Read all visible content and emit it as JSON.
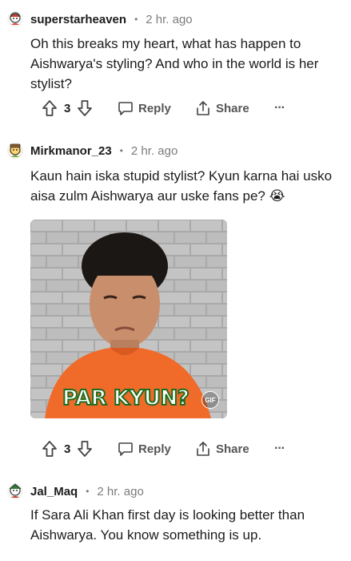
{
  "comments": [
    {
      "username": "superstarheaven",
      "time": "2 hr. ago",
      "body": "Oh this breaks my heart, what has happen to Aishwarya's styling? And who in the world is her stylist?",
      "votes": "3",
      "reply_label": "Reply",
      "share_label": "Share",
      "more_label": "···"
    },
    {
      "username": "Mirkmanor_23",
      "time": "2 hr. ago",
      "body": "Kaun hain iska stupid stylist? Kyun karna hai usko aisa zulm Aishwarya aur uske fans pe? 😭",
      "gif": {
        "caption": "PAR KYUN?",
        "badge": "GIF"
      },
      "votes": "3",
      "reply_label": "Reply",
      "share_label": "Share",
      "more_label": "···"
    },
    {
      "username": "Jal_Maq",
      "time": "2 hr. ago",
      "body": "If Sara Ali Khan first day is looking better than Aishwarya. You know something is up."
    }
  ],
  "separator": "•",
  "colors": {
    "text": "#1c1c1c",
    "muted": "#7c7c7c",
    "caption_stroke": "#1f6e1f"
  }
}
